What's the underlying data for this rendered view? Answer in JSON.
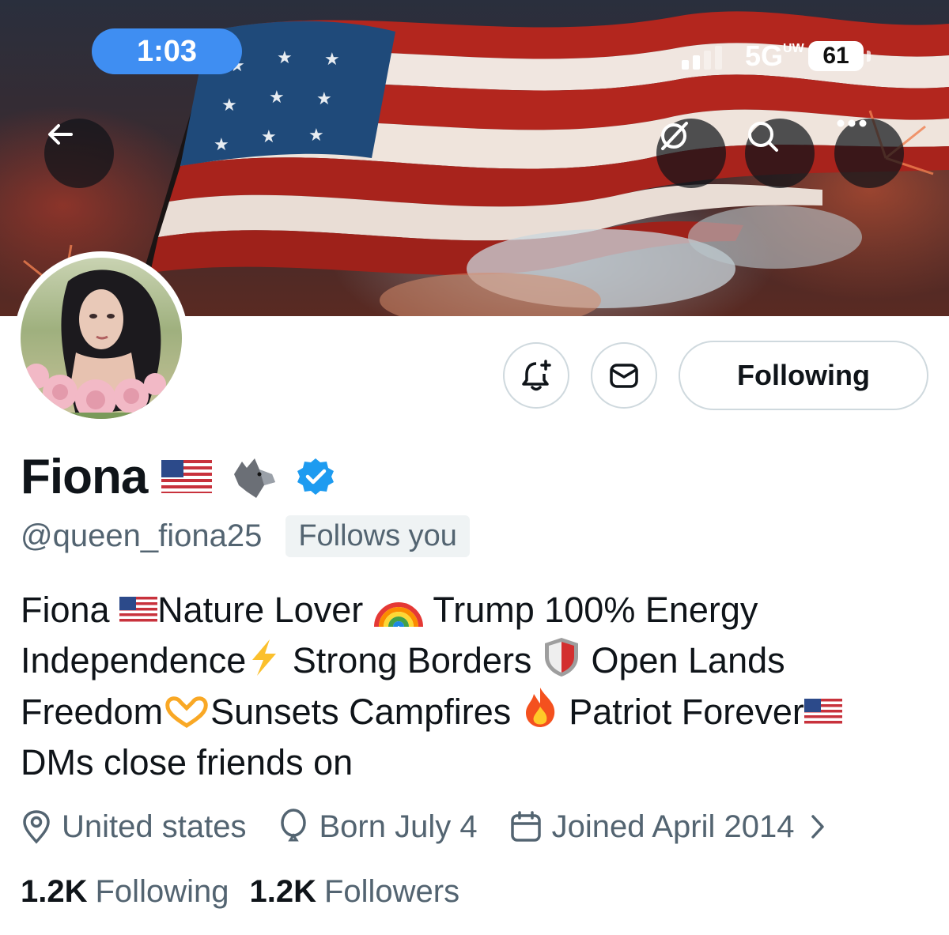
{
  "status_bar": {
    "time": "1:03",
    "network": "5G",
    "network_sub": "UW",
    "battery": "61"
  },
  "banner": {
    "icons": [
      "back-arrow-icon",
      "grok-icon",
      "search-icon",
      "more-icon"
    ]
  },
  "actions": {
    "following_label": "Following"
  },
  "profile": {
    "display_name": "Fiona",
    "handle": "@queen_fiona25",
    "follows_you": "Follows you",
    "bio": [
      [
        "Fiona ",
        "[flag]",
        "Nature Lover ",
        "[rainbow]",
        " Trump 100% Energy"
      ],
      [
        "Independence",
        "[bolt]",
        " Strong Borders ",
        "[shield]",
        " Open Lands"
      ],
      [
        "Freedom",
        "[hearthands]",
        "Sunsets Campfires ",
        "[fire]",
        " Patriot Forever",
        "[flag]"
      ],
      [
        "DMs close friends on"
      ]
    ],
    "bio_text": {
      "l1a": "Fiona ",
      "l1b": "Nature Lover ",
      "l1c": " Trump 100% Energy",
      "l2a": "Independence",
      "l2b": " Strong Borders ",
      "l2c": " Open Lands",
      "l3a": "Freedom",
      "l3b": "Sunsets Campfires ",
      "l3c": " Patriot Forever",
      "l4a": "DMs close friends on"
    },
    "location": "United  states",
    "birthday": "Born July 4",
    "joined": "Joined April 2014",
    "following_count": "1.2K",
    "following_label": "Following",
    "followers_count": "1.2K",
    "followers_label": "Followers"
  },
  "colors": {
    "accent_blue": "#3f8ef2",
    "verified_blue": "#1d9bf0",
    "secondary_text": "#536471",
    "border": "#cfd9de"
  }
}
